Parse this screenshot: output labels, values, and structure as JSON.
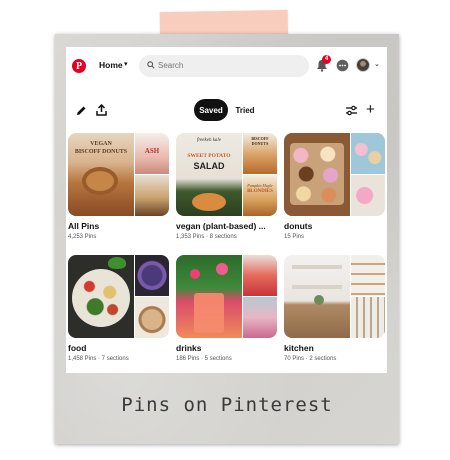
{
  "header": {
    "logo_letter": "P",
    "home_label": "Home",
    "search_placeholder": "Search",
    "notification_count": "4"
  },
  "toolbar": {
    "tabs": [
      {
        "label": "Saved",
        "active": true
      },
      {
        "label": "Tried",
        "active": false
      }
    ]
  },
  "boards": [
    {
      "title": "All Pins",
      "meta": "4,253 Pins",
      "thumb_texts": [
        "VEGAN",
        "BISCOFF DONUTS",
        "ASH"
      ]
    },
    {
      "title": "vegan (plant-based) ...",
      "meta": "1,353 Pins · 8 sections",
      "thumb_texts": [
        "freekeh kale",
        "SWEET POTATO",
        "SALAD",
        "BISCOFF DONUTS",
        "Pumpkin Maple",
        "BLONDIES"
      ]
    },
    {
      "title": "donuts",
      "meta": "15 Pins",
      "thumb_texts": []
    },
    {
      "title": "food",
      "meta": "1,458 Pins · 7 sections",
      "thumb_texts": []
    },
    {
      "title": "drinks",
      "meta": "186 Pins · 5 sections",
      "thumb_texts": []
    },
    {
      "title": "kitchen",
      "meta": "70 Pins · 2 sections",
      "thumb_texts": []
    }
  ],
  "caption": "Pins on Pinterest",
  "colors": {
    "brand_red": "#e60023",
    "tape": "#f7c4b2",
    "frame": "#d6d5d1"
  },
  "icons": [
    "pinterest-logo-icon",
    "search-icon",
    "bell-icon",
    "chat-icon",
    "chevron-down-icon",
    "pencil-icon",
    "share-icon",
    "filter-icon",
    "plus-icon"
  ]
}
